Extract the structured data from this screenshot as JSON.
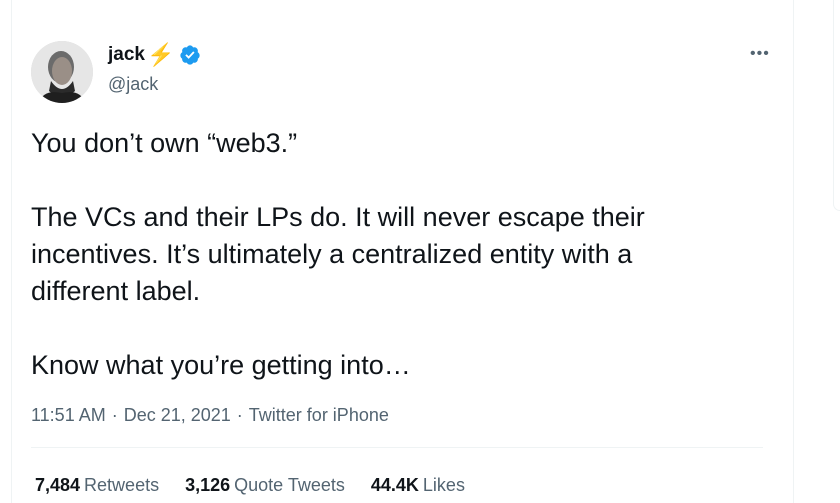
{
  "author": {
    "name": "jack",
    "handle": "@jack",
    "badge_icon": "lightning-bolt",
    "verified_icon": "verified-badge-icon",
    "verified_color": "#1d9bf0"
  },
  "menu": {
    "more_label": "•••"
  },
  "tweet": {
    "line1": "You don’t own “web3.”",
    "line2": "The VCs and their LPs do. It will never escape their",
    "line3": "incentives. It’s ultimately a centralized entity with a",
    "line4": "different label.",
    "line5": "Know what you’re getting into…"
  },
  "meta": {
    "time": "11:51 AM",
    "sep1": "·",
    "date": "Dec 21, 2021",
    "sep2": "·",
    "source": "Twitter for iPhone"
  },
  "stats": {
    "retweets_count": "7,484",
    "retweets_label": "Retweets",
    "quotes_count": "3,126",
    "quotes_label": "Quote Tweets",
    "likes_count": "44.4K",
    "likes_label": "Likes"
  }
}
